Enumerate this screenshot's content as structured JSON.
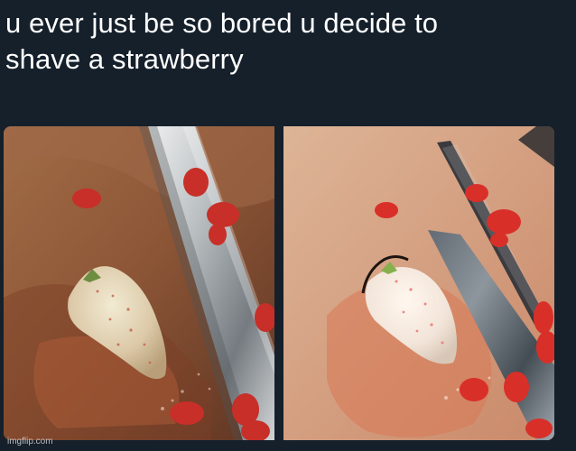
{
  "meme": {
    "caption_lines": [
      "u ever just be so bored u decide to",
      "shave a strawberry"
    ],
    "watermark": "imgflip.com"
  },
  "photos": [
    {
      "scene": "shaved strawberry on cutting board with knife, darker exposure"
    },
    {
      "scene": "shaved strawberry on cutting board with knife, brighter exposure"
    }
  ]
}
